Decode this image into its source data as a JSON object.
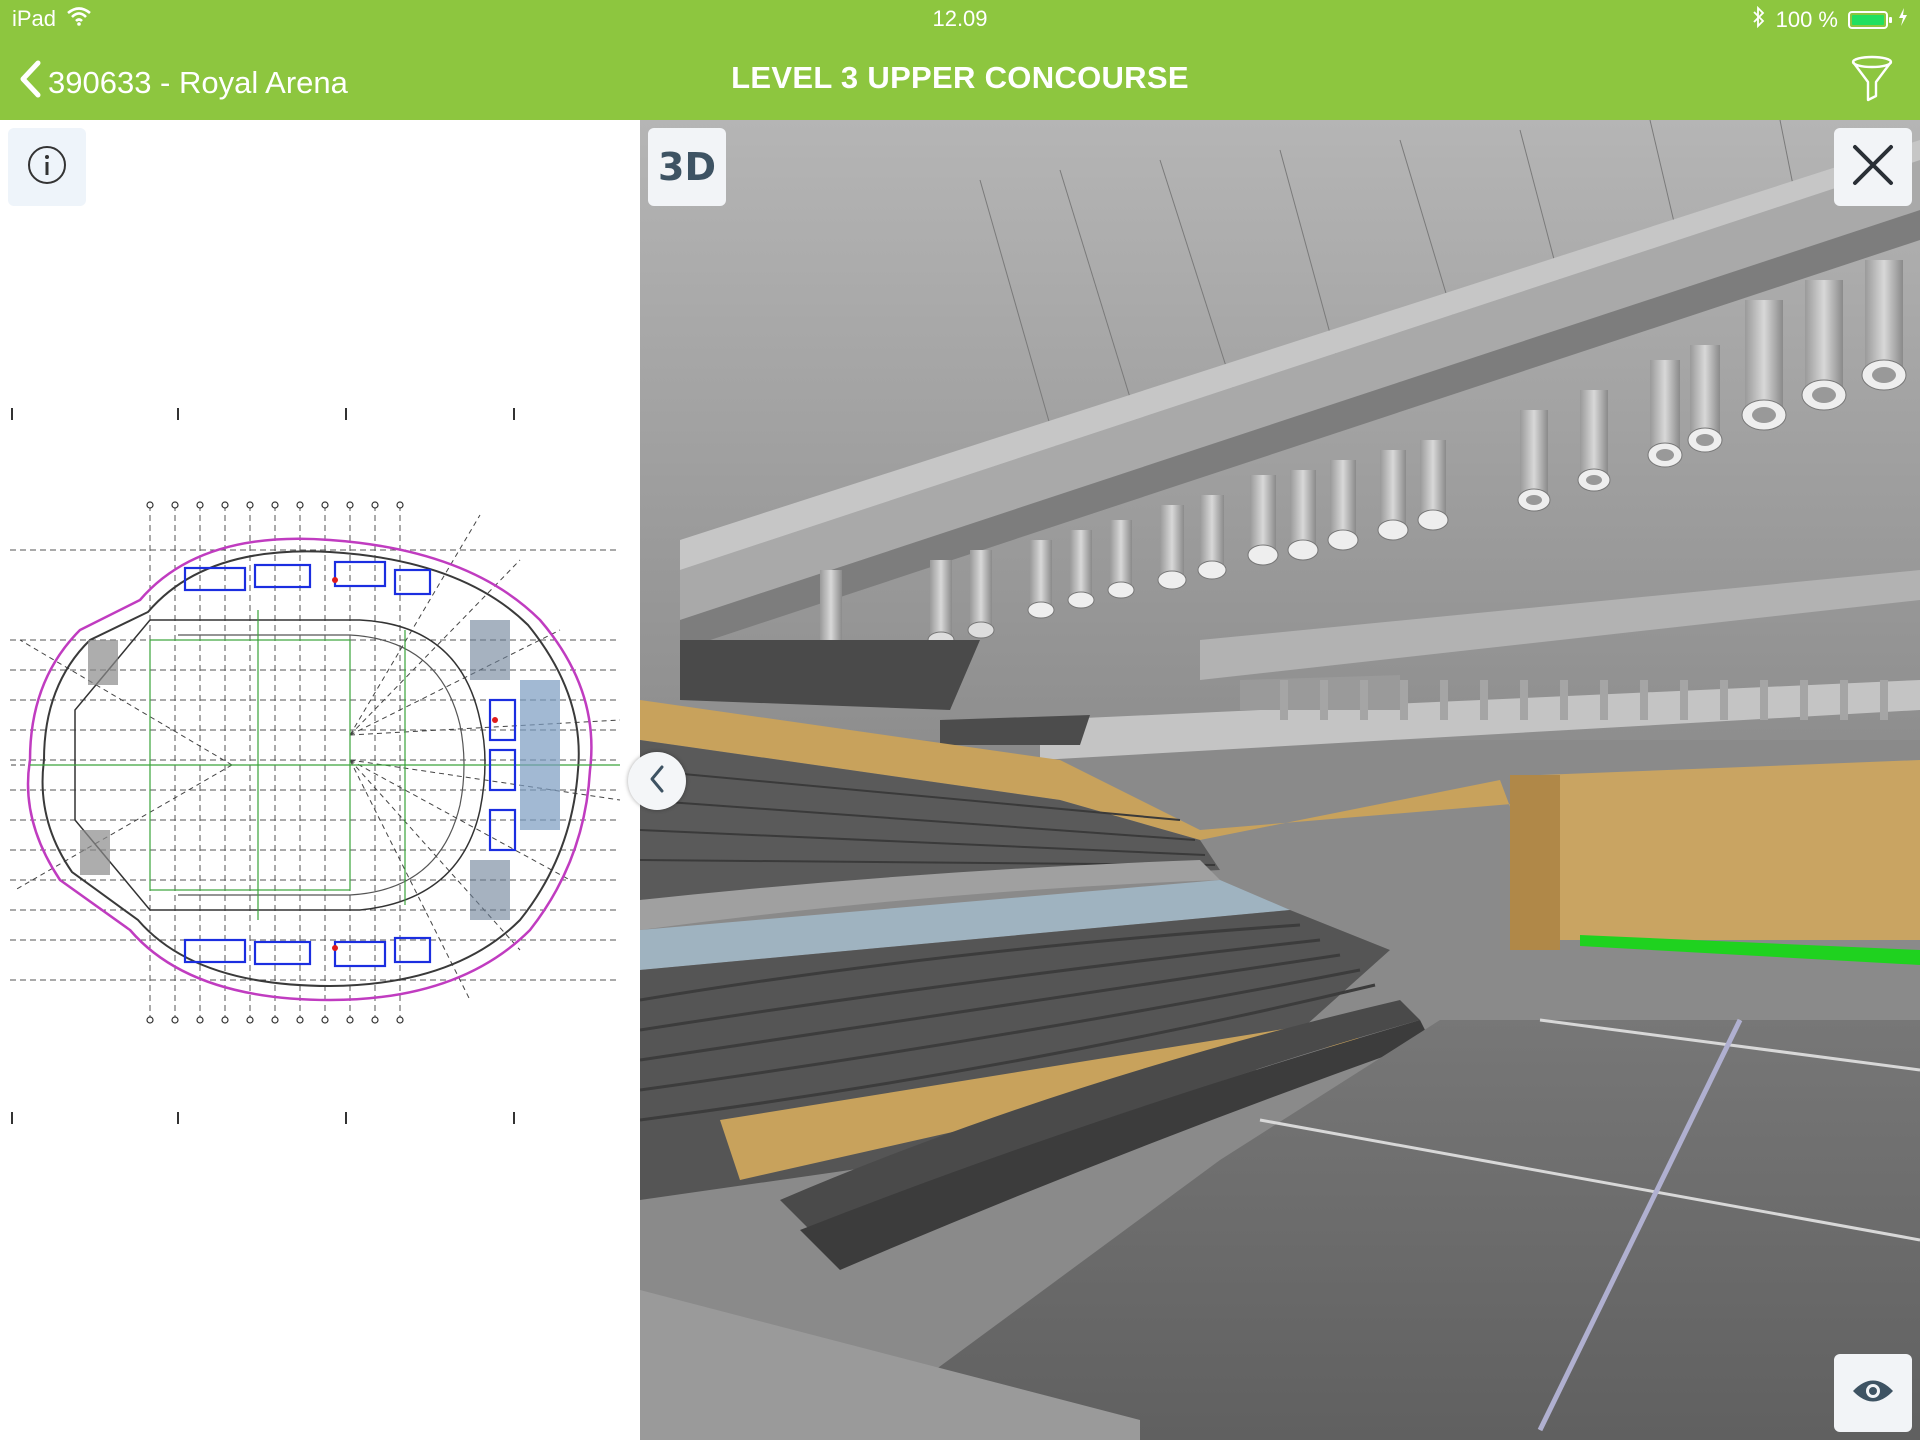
{
  "status_bar": {
    "device": "iPad",
    "time": "12.09",
    "battery": "100 %"
  },
  "nav": {
    "back_label": "390633 - Royal Arena",
    "title": "LEVEL 3 UPPER CONCOURSE"
  },
  "viewer": {
    "mode_label": "3D"
  },
  "colors": {
    "header": "#8dc63f",
    "panel_button": "#f2f4f7",
    "seat_accent": "#c8a25c",
    "railing": "#1fd21f"
  },
  "icons": [
    "wifi-icon",
    "bluetooth-icon",
    "battery-icon",
    "chevron-left-icon",
    "filter-icon",
    "info-icon",
    "close-icon",
    "eye-icon"
  ]
}
